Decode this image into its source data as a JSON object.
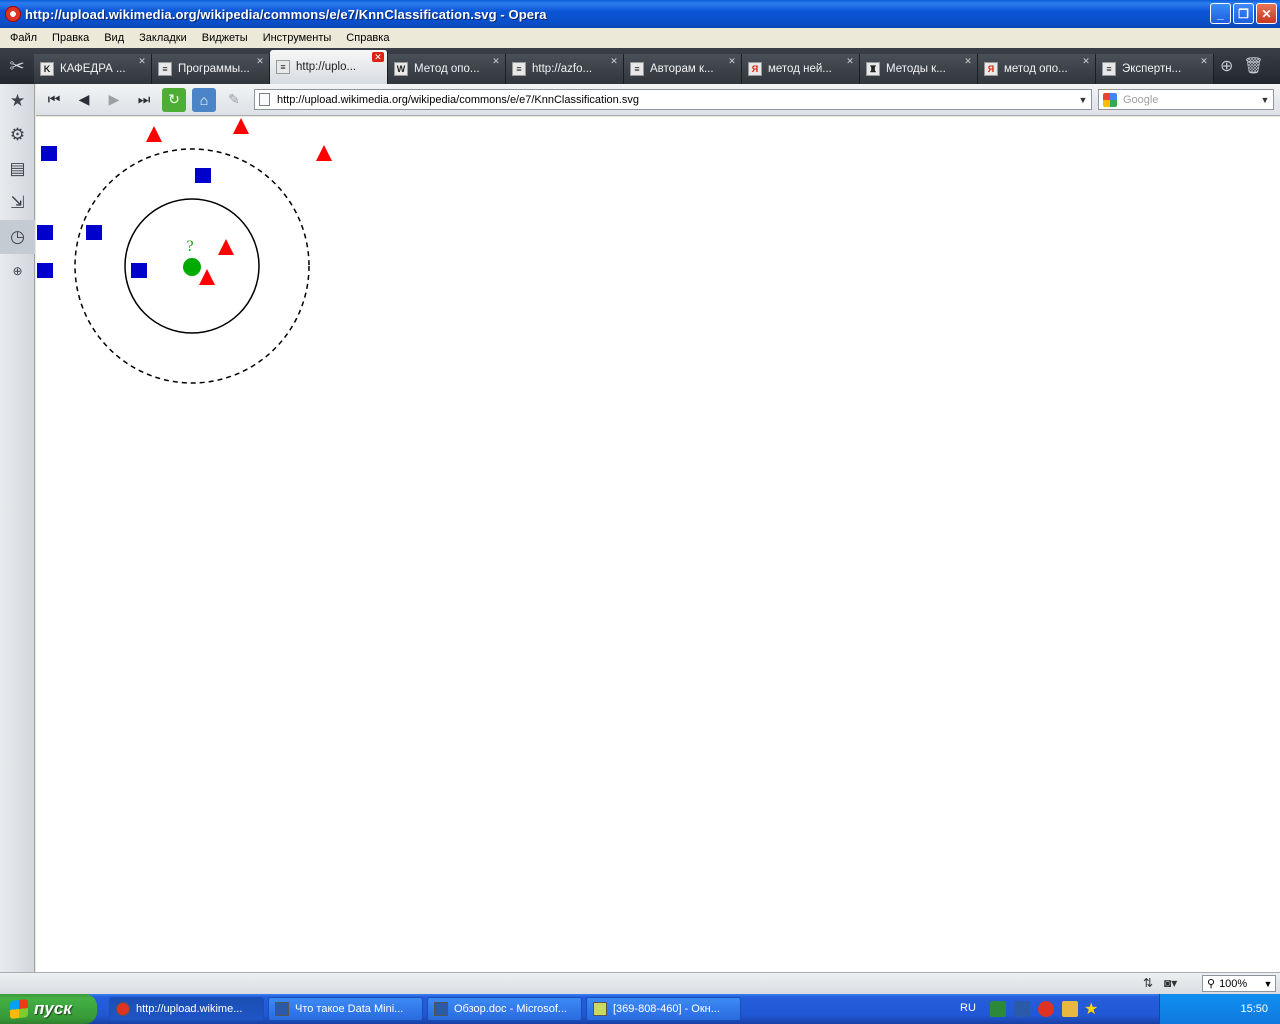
{
  "window": {
    "title": "http://upload.wikimedia.org/wikipedia/commons/e/e7/KnnClassification.svg - Opera",
    "minimize": "_",
    "restore": "❐",
    "close": "✕"
  },
  "menu": [
    "Файл",
    "Правка",
    "Вид",
    "Закладки",
    "Виджеты",
    "Инструменты",
    "Справка"
  ],
  "tabs": [
    {
      "label": "КАФЕДРА ...",
      "icon": "K"
    },
    {
      "label": "Программы...",
      "icon": "≡"
    },
    {
      "label": "http://uplo...",
      "icon": "≡",
      "active": true
    },
    {
      "label": "Метод опо...",
      "icon": "W"
    },
    {
      "label": "http://azfo...",
      "icon": "≡"
    },
    {
      "label": "Авторам к...",
      "icon": "≡"
    },
    {
      "label": "метод ней...",
      "icon": "Я"
    },
    {
      "label": "Методы к...",
      "icon": "♜"
    },
    {
      "label": "метод опо...",
      "icon": "Я"
    },
    {
      "label": "Экспертн...",
      "icon": "≡"
    }
  ],
  "address_bar": {
    "url": "http://upload.wikimedia.org/wikipedia/commons/e/e7/KnnClassification.svg"
  },
  "search_box": {
    "placeholder": "Google"
  },
  "svg_content": {
    "query_label": "?",
    "colors": {
      "class_a": "#0000cc",
      "class_b": "#ff0000",
      "query": "#00aa00"
    }
  },
  "status": {
    "zoom": "100%"
  },
  "taskbar": {
    "start_label": "пуск",
    "tasks": [
      {
        "label": "http://upload.wikime..."
      },
      {
        "label": "Что такое Data Mini..."
      },
      {
        "label": "Обзор.doc - Microsof..."
      },
      {
        "label": "[369-808-460] - Окн..."
      }
    ],
    "language": "RU",
    "clock": "15:50"
  }
}
